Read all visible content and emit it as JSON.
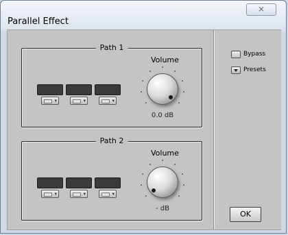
{
  "window": {
    "title": "Parallel Effect",
    "close_label": "⨯"
  },
  "paths": [
    {
      "title": "Path 1",
      "volume_label": "Volume",
      "volume_value": "0.0 dB",
      "knob_rotation_deg": 135
    },
    {
      "title": "Path 2",
      "volume_label": "Volume",
      "volume_value": "- dB",
      "knob_rotation_deg": 225
    }
  ],
  "options": {
    "bypass_label": "Bypass",
    "presets_label": "Presets"
  },
  "ok_label": "OK",
  "icons": {
    "close": "close-icon",
    "dropdown": "chevron-down-icon"
  },
  "colors": {
    "panel": "#c4c4c4",
    "slot": "#3a3a3a",
    "title_bg": "#dfe6ef"
  }
}
